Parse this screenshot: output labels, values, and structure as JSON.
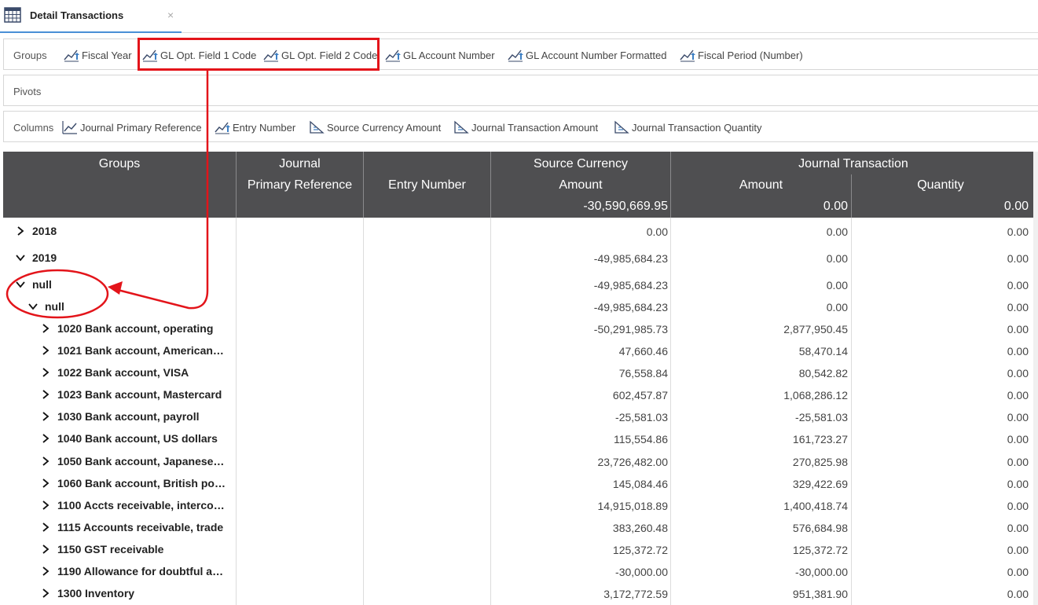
{
  "tab": {
    "title": "Detail Transactions",
    "close": "×"
  },
  "groups_bar": {
    "label": "Groups",
    "chips": [
      "Fiscal Year",
      "GL Opt. Field 1 Code",
      "GL Opt. Field 2 Code",
      "GL Account Number",
      "GL Account Number Formatted",
      "Fiscal Period (Number)"
    ]
  },
  "pivots_bar": {
    "label": "Pivots"
  },
  "columns_bar": {
    "label": "Columns",
    "chips": [
      "Journal Primary Reference",
      "Entry Number",
      "Source Currency Amount",
      "Journal Transaction Amount",
      "Journal Transaction Quantity"
    ]
  },
  "grid": {
    "headers": {
      "groups": "Groups",
      "journal_line1": "Journal",
      "journal_line2": "Primary Reference",
      "entry_number": "Entry Number",
      "source_line1": "Source Currency",
      "source_line2": "Amount",
      "jt_group": "Journal Transaction",
      "jt_amount": "Amount",
      "jt_quantity": "Quantity"
    },
    "totals": {
      "source": "-30,590,669.95",
      "amount": "0.00",
      "quantity": "0.00"
    },
    "rows": [
      {
        "label": "2018",
        "expanded": false,
        "level": 0,
        "source": "0.00",
        "amount": "0.00",
        "quantity": "0.00"
      },
      {
        "label": "2019",
        "expanded": true,
        "level": 0,
        "source": "-49,985,684.23",
        "amount": "0.00",
        "quantity": "0.00"
      },
      {
        "label": "null",
        "expanded": true,
        "level": 1,
        "source": "-49,985,684.23",
        "amount": "0.00",
        "quantity": "0.00"
      },
      {
        "label": "null",
        "expanded": true,
        "level": 2,
        "source": "-49,985,684.23",
        "amount": "0.00",
        "quantity": "0.00"
      },
      {
        "label": "1020 Bank account, operating",
        "expanded": false,
        "level": 3,
        "source": "-50,291,985.73",
        "amount": "2,877,950.45",
        "quantity": "0.00"
      },
      {
        "label": "1021 Bank account, American…",
        "expanded": false,
        "level": 3,
        "source": "47,660.46",
        "amount": "58,470.14",
        "quantity": "0.00"
      },
      {
        "label": "1022 Bank account, VISA",
        "expanded": false,
        "level": 3,
        "source": "76,558.84",
        "amount": "80,542.82",
        "quantity": "0.00"
      },
      {
        "label": "1023 Bank account, Mastercard",
        "expanded": false,
        "level": 3,
        "source": "602,457.87",
        "amount": "1,068,286.12",
        "quantity": "0.00"
      },
      {
        "label": "1030 Bank account, payroll",
        "expanded": false,
        "level": 3,
        "source": "-25,581.03",
        "amount": "-25,581.03",
        "quantity": "0.00"
      },
      {
        "label": "1040 Bank account, US dollars",
        "expanded": false,
        "level": 3,
        "source": "115,554.86",
        "amount": "161,723.27",
        "quantity": "0.00"
      },
      {
        "label": "1050 Bank account, Japanese…",
        "expanded": false,
        "level": 3,
        "source": "23,726,482.00",
        "amount": "270,825.98",
        "quantity": "0.00"
      },
      {
        "label": "1060 Bank account, British po…",
        "expanded": false,
        "level": 3,
        "source": "145,084.46",
        "amount": "329,422.69",
        "quantity": "0.00"
      },
      {
        "label": "1100 Accts receivable, interco…",
        "expanded": false,
        "level": 3,
        "source": "14,915,018.89",
        "amount": "1,400,418.74",
        "quantity": "0.00"
      },
      {
        "label": "1115 Accounts receivable, trade",
        "expanded": false,
        "level": 3,
        "source": "383,260.48",
        "amount": "576,684.98",
        "quantity": "0.00"
      },
      {
        "label": "1150 GST receivable",
        "expanded": false,
        "level": 3,
        "source": "125,372.72",
        "amount": "125,372.72",
        "quantity": "0.00"
      },
      {
        "label": "1190 Allowance for doubtful a…",
        "expanded": false,
        "level": 3,
        "source": "-30,000.00",
        "amount": "-30,000.00",
        "quantity": "0.00"
      },
      {
        "label": "1300 Inventory",
        "expanded": false,
        "level": 3,
        "source": "3,172,772.59",
        "amount": "951,381.90",
        "quantity": "0.00"
      }
    ]
  },
  "colors": {
    "header_bg": "#4f4f51",
    "highlight": "#e3141a",
    "tab_accent": "#4a8fd6"
  }
}
